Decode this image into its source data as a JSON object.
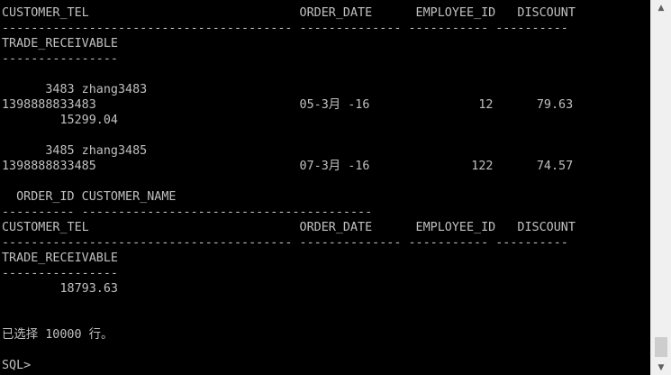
{
  "console": {
    "lines": [
      "CUSTOMER_TEL                             ORDER_DATE      EMPLOYEE_ID   DISCOUNT",
      "---------------------------------------- -------------- ----------- ----------",
      "TRADE_RECEIVABLE",
      "----------------",
      "",
      "      3483 zhang3483",
      "1398888833483                            05-3月 -16               12      79.63",
      "        15299.04",
      "",
      "      3485 zhang3485",
      "1398888833485                            07-3月 -16              122      74.57",
      "",
      "  ORDER_ID CUSTOMER_NAME",
      "---------- ----------------------------------------",
      "CUSTOMER_TEL                             ORDER_DATE      EMPLOYEE_ID   DISCOUNT",
      "---------------------------------------- -------------- ----------- ----------",
      "TRADE_RECEIVABLE",
      "----------------",
      "        18793.63",
      "",
      "",
      "已选择 10000 行。",
      "",
      "SQL>"
    ]
  },
  "scrollbar": {
    "up_icon": "▲",
    "down_icon": "▼"
  }
}
